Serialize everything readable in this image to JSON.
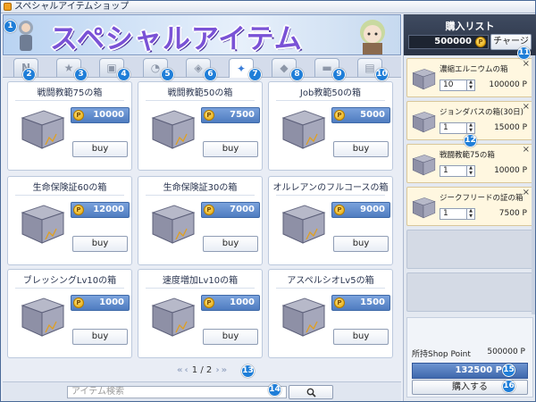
{
  "window": {
    "title": "スペシャルアイテムショップ"
  },
  "banner": {
    "title": "スペシャルアイテム"
  },
  "tabs": [
    {
      "name": "tab-new",
      "icon": "new-icon",
      "glyph": "N"
    },
    {
      "name": "tab-favorite",
      "icon": "star-icon",
      "glyph": "★"
    },
    {
      "name": "tab-box",
      "icon": "gift-box-icon",
      "glyph": "▣"
    },
    {
      "name": "tab-potion",
      "icon": "potion-icon",
      "glyph": "◔"
    },
    {
      "name": "tab-armor",
      "icon": "shield-icon",
      "glyph": "◈"
    },
    {
      "name": "tab-special",
      "icon": "sparkle-icon",
      "glyph": "✦"
    },
    {
      "name": "tab-pet",
      "icon": "pet-icon",
      "glyph": "◆"
    },
    {
      "name": "tab-folder",
      "icon": "folder-icon",
      "glyph": "▬"
    },
    {
      "name": "tab-ticket",
      "icon": "ticket-icon",
      "glyph": "▤"
    }
  ],
  "items": [
    {
      "name": "戦闘教範75の箱",
      "price": "10000",
      "buy": "buy"
    },
    {
      "name": "戦闘教範50の箱",
      "price": "7500",
      "buy": "buy"
    },
    {
      "name": "Job教範50の箱",
      "price": "5000",
      "buy": "buy"
    },
    {
      "name": "生命保険証60の箱",
      "price": "12000",
      "buy": "buy"
    },
    {
      "name": "生命保険証30の箱",
      "price": "7000",
      "buy": "buy"
    },
    {
      "name": "オルレアンのフルコースの箱",
      "price": "9000",
      "buy": "buy"
    },
    {
      "name": "ブレッシングLv10の箱",
      "price": "1000",
      "buy": "buy"
    },
    {
      "name": "速度増加Lv10の箱",
      "price": "1000",
      "buy": "buy"
    },
    {
      "name": "アスペルシオLv5の箱",
      "price": "1500",
      "buy": "buy"
    }
  ],
  "pager": {
    "current": "1",
    "sep": "/",
    "total": "2"
  },
  "search": {
    "placeholder": "アイテム検索"
  },
  "cart": {
    "title": "購入リスト",
    "points": "500000",
    "charge_label": "チャージ",
    "items": [
      {
        "name": "濃縮エルニウムの箱",
        "qty": "10",
        "price": "100000 P"
      },
      {
        "name": "ジョンダパスの箱(30日)",
        "qty": "1",
        "price": "15000 P"
      },
      {
        "name": "戦闘教範75の箱",
        "qty": "1",
        "price": "10000 P"
      },
      {
        "name": "ジークフリードの証の箱",
        "qty": "1",
        "price": "7500 P"
      }
    ]
  },
  "summary": {
    "owned_label": "所持Shop Point",
    "owned_value": "500000 P",
    "total": "132500 P",
    "purchase_label": "購入する"
  },
  "badges": [
    "1",
    "2",
    "3",
    "4",
    "5",
    "6",
    "7",
    "8",
    "9",
    "10",
    "11",
    "12",
    "13",
    "14",
    "15",
    "16"
  ]
}
